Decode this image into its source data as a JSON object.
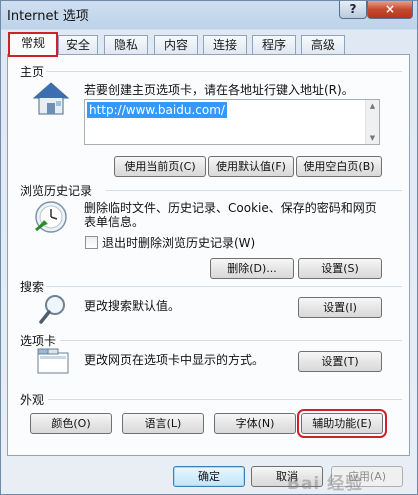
{
  "window": {
    "title": "Internet 选项",
    "help": "?",
    "close": "×"
  },
  "tabs": [
    {
      "label": "常规"
    },
    {
      "label": "安全"
    },
    {
      "label": "隐私"
    },
    {
      "label": "内容"
    },
    {
      "label": "连接"
    },
    {
      "label": "程序"
    },
    {
      "label": "高级"
    }
  ],
  "home": {
    "section": "主页",
    "description": "若要创建主页选项卡，请在各地址行键入地址(R)。",
    "url": "http://www.baidu.com/",
    "buttons": {
      "use_current": "使用当前页(C)",
      "use_default": "使用默认值(F)",
      "use_blank": "使用空白页(B)"
    }
  },
  "history": {
    "section": "浏览历史记录",
    "description_line1": "删除临时文件、历史记录、Cookie、保存的密码和网页",
    "description_line2": "表单信息。",
    "checkbox_label": "退出时删除浏览历史记录(W)",
    "delete_button": "删除(D)...",
    "settings_button": "设置(S)"
  },
  "search": {
    "section": "搜索",
    "description": "更改搜索默认值。",
    "settings_button": "设置(I)"
  },
  "tabs_section": {
    "section": "选项卡",
    "description": "更改网页在选项卡中显示的方式。",
    "settings_button": "设置(T)"
  },
  "appearance": {
    "section": "外观",
    "colors": "颜色(O)",
    "languages": "语言(L)",
    "fonts": "字体(N)",
    "accessibility": "辅助功能(E)"
  },
  "footer": {
    "ok": "确定",
    "cancel": "取消",
    "apply": "应用(A)"
  },
  "watermark": "Bai 经验"
}
